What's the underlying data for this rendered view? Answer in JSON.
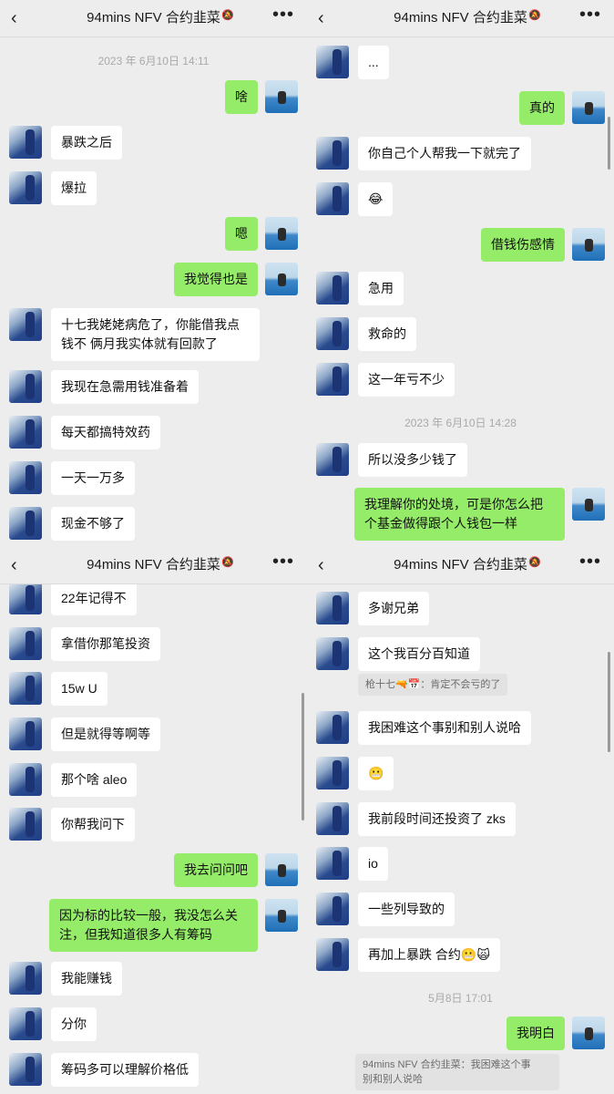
{
  "chat": {
    "title": "94mins NFV 合约韭菜",
    "back_icon": "chevron-left-icon",
    "mute_icon": "bell-slash-icon",
    "more_icon": "ellipsis-icon"
  },
  "panels": [
    {
      "timestamps": [
        "2023 年 6月10日 14:11"
      ],
      "messages": [
        {
          "side": "right",
          "text": "啥"
        },
        {
          "side": "left",
          "text": "暴跌之后"
        },
        {
          "side": "left",
          "text": "爆拉"
        },
        {
          "side": "right",
          "text": "嗯"
        },
        {
          "side": "right",
          "text": "我觉得也是"
        },
        {
          "side": "left",
          "text": "十七我姥姥病危了，你能借我点\n钱不 俩月我实体就有回款了"
        },
        {
          "side": "left",
          "text": "我现在急需用钱准备着"
        },
        {
          "side": "left",
          "text": "每天都搞特效药"
        },
        {
          "side": "left",
          "text": "一天一万多"
        },
        {
          "side": "left",
          "text": "现金不够了"
        }
      ]
    },
    {
      "timestamps": [
        "2023 年 6月10日 14:28"
      ],
      "messages": [
        {
          "side": "left",
          "text": "..."
        },
        {
          "side": "right",
          "text": "真的"
        },
        {
          "side": "left",
          "text": "你自己个人帮我一下就完了"
        },
        {
          "side": "left",
          "text": "😂"
        },
        {
          "side": "right",
          "text": "借钱伤感情"
        },
        {
          "side": "left",
          "text": "急用"
        },
        {
          "side": "left",
          "text": "救命的"
        },
        {
          "side": "left",
          "text": "这一年亏不少"
        },
        {
          "side": "left",
          "text": "所以没多少钱了"
        },
        {
          "side": "right",
          "text": "我理解你的处境，可是你怎么把\n个基金做得跟个人钱包一样"
        }
      ]
    },
    {
      "timestamps": [],
      "messages": [
        {
          "side": "left",
          "text": "22年记得不"
        },
        {
          "side": "left",
          "text": "拿借你那笔投资"
        },
        {
          "side": "left",
          "text": "15w U"
        },
        {
          "side": "left",
          "text": "但是就得等啊等"
        },
        {
          "side": "left",
          "text": "那个啥 aleo"
        },
        {
          "side": "left",
          "text": "你帮我问下"
        },
        {
          "side": "right",
          "text": "我去问问吧"
        },
        {
          "side": "right",
          "text": "因为标的比较一般，我没怎么关\n注，但我知道很多人有筹码"
        },
        {
          "side": "left",
          "text": "我能赚钱"
        },
        {
          "side": "left",
          "text": "分你"
        },
        {
          "side": "left",
          "text": "筹码多可以理解价格低"
        }
      ]
    },
    {
      "timestamps": [
        "5月8日 17:01"
      ],
      "messages": [
        {
          "side": "left",
          "text": "多谢兄弟"
        },
        {
          "side": "left",
          "text": "这个我百分百知道"
        },
        {
          "side": "left",
          "text": "我困难这个事别和别人说哈"
        },
        {
          "side": "left",
          "text": "😬"
        },
        {
          "side": "left",
          "text": "我前段时间还投资了 zks"
        },
        {
          "side": "left",
          "text": "io"
        },
        {
          "side": "left",
          "text": "一些列导致的"
        },
        {
          "side": "left",
          "text": "再加上暴跌 合约😬🙀"
        },
        {
          "side": "right",
          "text": "我明白"
        }
      ],
      "quotes": [
        "枪十七🔫📅：肯定不会亏的了",
        "94mins NFV 合约韭菜：我困难这个事\n别和别人说哈"
      ]
    }
  ]
}
